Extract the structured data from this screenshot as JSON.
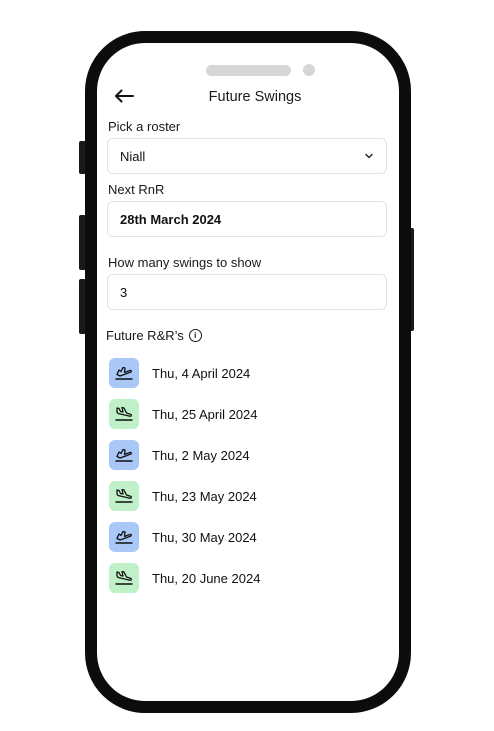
{
  "header": {
    "title": "Future Swings"
  },
  "roster": {
    "label": "Pick a roster",
    "value": "Niall"
  },
  "next_rnr": {
    "label": "Next RnR",
    "value": "28th March 2024"
  },
  "swings_count": {
    "label": "How many swings to show",
    "value": "3"
  },
  "future_rr": {
    "title": "Future R&R’s",
    "items": [
      {
        "label": "Thu, 4 April 2024",
        "icon": "plane-departure-icon",
        "color": "#a9c8f7"
      },
      {
        "label": "Thu, 25 April 2024",
        "icon": "plane-arrival-icon",
        "color": "#bff0c7"
      },
      {
        "label": "Thu, 2 May 2024",
        "icon": "plane-departure-icon",
        "color": "#a9c8f7"
      },
      {
        "label": "Thu, 23 May 2024",
        "icon": "plane-arrival-icon",
        "color": "#bff0c7"
      },
      {
        "label": "Thu, 30 May 2024",
        "icon": "plane-departure-icon",
        "color": "#a9c8f7"
      },
      {
        "label": "Thu, 20 June 2024",
        "icon": "plane-arrival-icon",
        "color": "#bff0c7"
      }
    ]
  }
}
